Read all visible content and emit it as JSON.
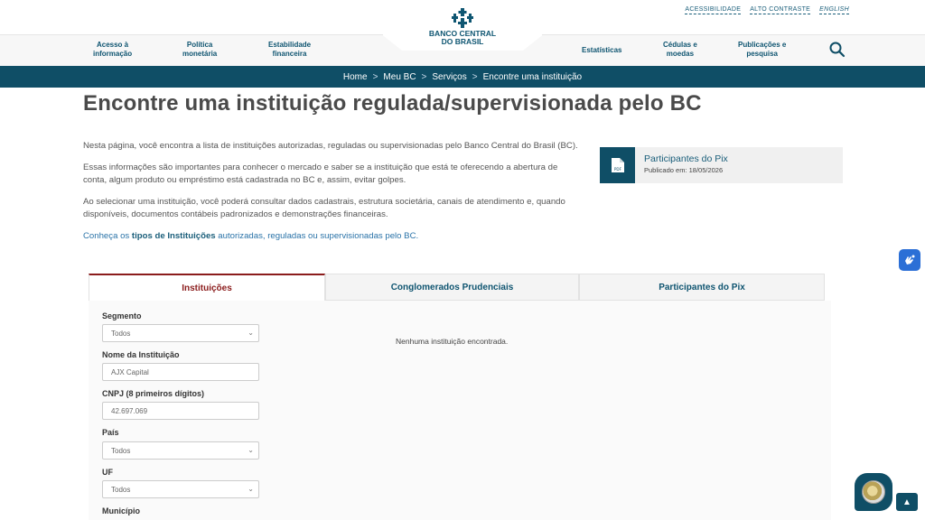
{
  "util_links": {
    "accessibility": "ACESSIBILIDADE",
    "contrast": "ALTO CONTRASTE",
    "english": "ENGLISH"
  },
  "logo": {
    "line1": "BANCO CENTRAL",
    "line2": "DO BRASIL"
  },
  "nav": {
    "acesso": [
      "Acesso à",
      "informação"
    ],
    "politica": [
      "Política",
      "monetária"
    ],
    "estabilidade": [
      "Estabilidade",
      "financeira"
    ],
    "estatisticas": "Estatísticas",
    "cedulas": [
      "Cédulas e",
      "moedas"
    ],
    "publicacoes": [
      "Publicações e",
      "pesquisa"
    ]
  },
  "breadcrumb": [
    "Home",
    "Meu BC",
    "Serviços",
    "Encontre uma instituição"
  ],
  "breadcrumb_sep": ">",
  "page_title": "Encontre uma instituição regulada/supervisionada pelo BC",
  "intro": {
    "p1": "Nesta página, você encontra a lista de instituições autorizadas, reguladas ou supervisionadas pelo Banco Central do Brasil (BC).",
    "p2": "Essas informações são importantes para conhecer o mercado e saber se a instituição que está te oferecendo a abertura de conta, algum produto ou empréstimo está cadastrada no BC e, assim, evitar golpes.",
    "p3": "Ao selecionar uma instituição, você poderá consultar dados cadastrais, estrutura societária, canais de atendimento e, quando disponíveis, documentos contábeis padronizados e demonstrações financeiras.",
    "p4_pre": "Conheça os ",
    "p4_bold": "tipos de Instituições",
    "p4_post": " autorizadas, reguladas ou supervisionadas pelo BC."
  },
  "pix_card": {
    "title": "Participantes do Pix",
    "date": "Publicado em: 18/05/2026",
    "doc_type": "PDF"
  },
  "tabs": [
    "Instituições",
    "Conglomerados Prudenciais",
    "Participantes do Pix"
  ],
  "form": {
    "segmento_label": "Segmento",
    "segmento_value": "Todos",
    "nome_label": "Nome da Instituição",
    "nome_value": "AJX Capital",
    "cnpj_label": "CNPJ (8 primeiros dígitos)",
    "cnpj_value": "42.697.069",
    "pais_label": "País",
    "pais_value": "Todos",
    "uf_label": "UF",
    "uf_value": "Todos",
    "municipio_label": "Município"
  },
  "empty_message": "Nenhuma instituição encontrada.",
  "colors": {
    "primary": "#0f4e66",
    "active_tab": "#8b1c1c",
    "link": "#2a73a8"
  }
}
